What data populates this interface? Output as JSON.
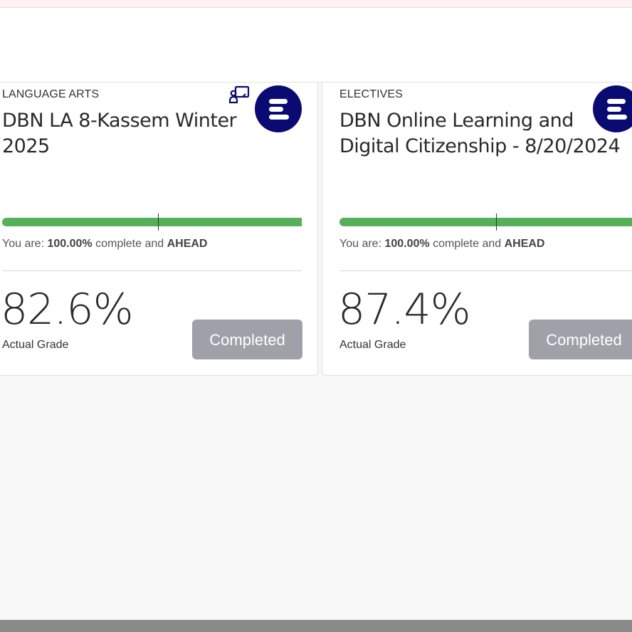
{
  "courses": [
    {
      "category": "LANGUAGE ARTS",
      "title": "DBN LA 8-Kassem Winter 2025",
      "progress_fraction": 1.0,
      "pace_marker_fraction": 0.52,
      "status_prefix": "You are: ",
      "status_percent": "100.00%",
      "status_middle": " complete and ",
      "status_pace": "AHEAD",
      "grade": "82.6%",
      "grade_label": "Actual Grade",
      "button_label": "Completed",
      "has_classroom_icon": true,
      "icons": [
        "classroom-icon",
        "edmentum-logo-icon"
      ]
    },
    {
      "category": "ELECTIVES",
      "title": "DBN Online Learning and Digital Citizenship - 8/20/2024",
      "progress_fraction": 1.0,
      "pace_marker_fraction": 0.5,
      "status_prefix": "You are: ",
      "status_percent": "100.00%",
      "status_middle": " complete and ",
      "status_pace": "AHEAD",
      "grade": "87.4%",
      "grade_label": "Actual Grade",
      "button_label": "Completed",
      "has_classroom_icon": false,
      "icons": [
        "edmentum-logo-icon"
      ]
    }
  ],
  "colors": {
    "progress_fill": "#55b05a",
    "logo_bg": "#0a0a73",
    "button_bg": "#9ea1a8"
  }
}
